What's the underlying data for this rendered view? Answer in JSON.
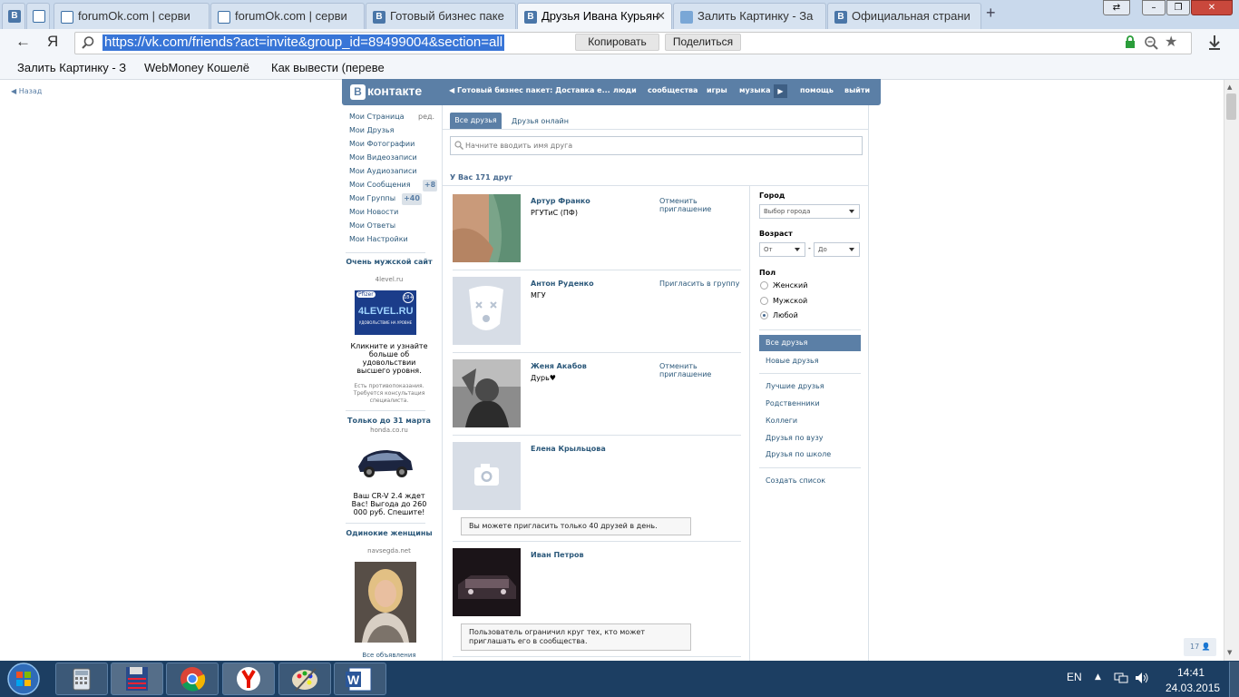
{
  "browser": {
    "tabs": [
      {
        "label": "forumOk.com | серви"
      },
      {
        "label": "forumOk.com | серви"
      },
      {
        "label": "Готовый бизнес паке"
      },
      {
        "label": "Друзья Ивана Курьян"
      },
      {
        "label": "Залить Картинку - За"
      },
      {
        "label": "Официальная страни"
      }
    ],
    "address": {
      "logo": "Я",
      "url": "https://vk.com/friends?act=invite&group_id=89499004&section=all",
      "copy_label": "Копировать",
      "share_label": "Поделиться"
    },
    "bookmarks": [
      "Залить Картинку - З",
      "WebMoney Кошелё",
      "Как вывести (переве"
    ]
  },
  "page": {
    "back_label": "Назад",
    "header": {
      "logo": "контакте",
      "logo_letter": "В",
      "app_link": "Готовый бизнес пакет: Доставка е...",
      "nav": [
        "люди",
        "сообщества",
        "игры",
        "музыка",
        "помощь",
        "выйти"
      ]
    },
    "sidebar": {
      "items": [
        "Мои Страница",
        "Мои Друзья",
        "Мои Фотографии",
        "Мои Видеозаписи",
        "Мои Аудиозаписи",
        "Мои Сообщения",
        "Мои Группы",
        "Мои Новости",
        "Мои Ответы",
        "Мои Настройки"
      ],
      "edit_label": "ред.",
      "messages_count": "+8",
      "groups_count": "+40",
      "ads": [
        {
          "title": "Очень мужской сайт",
          "site": "4level.ru",
          "image_brand": "4LEVEL.RU",
          "image_sub": "УДОВОЛЬСТВИЕ НА УРОВНЕ",
          "image_badge": "Pfizer",
          "image_age": "18+",
          "text": "Кликните и узнайте больше об удовольствии высшего уровня.",
          "disclaimer": "Есть противопоказания. Требуется консультация специалиста."
        },
        {
          "title": "Только до 31 марта",
          "site": "honda.co.ru",
          "text": "Ваш CR-V 2.4 ждет Вас! Выгода до 260 000 руб. Спешите!"
        },
        {
          "title": "Одинокие женщины",
          "site": "navsegda.net"
        }
      ],
      "all_ads_label": "Все объявления"
    },
    "main": {
      "tabs": [
        "Все друзья",
        "Друзья онлайн"
      ],
      "search_placeholder": "Начните вводить имя друга",
      "count_text": "У Вас 171 друг",
      "friends": [
        {
          "name": "Артур Франко",
          "sub": "РГУТиС (ПФ)",
          "action": "Отменить приглашение"
        },
        {
          "name": "Антон Руденко",
          "sub": "МГУ",
          "action": "Пригласить в группу"
        },
        {
          "name": "Женя Акабов",
          "sub": "Дурь♥",
          "action": "Отменить приглашение"
        },
        {
          "name": "Елена Крыльцова",
          "note": "Вы можете пригласить только 40 друзей в день."
        },
        {
          "name": "Иван Петров",
          "note": "Пользователь ограничил круг тех, кто может приглашать его в сообщества."
        }
      ]
    },
    "filters": {
      "city_label": "Город",
      "city_value": "Выбор города",
      "age_label": "Возраст",
      "age_from": "От",
      "age_to": "До",
      "age_sep": "-",
      "sex_label": "Пол",
      "sex_options": [
        "Женский",
        "Мужской",
        "Любой"
      ],
      "sex_selected": "Любой",
      "menu_active": "Все друзья",
      "menu": [
        "Новые друзья",
        "Лучшие друзья",
        "Родственники",
        "Коллеги",
        "Друзья по вузу",
        "Друзья по школе",
        "Создать список"
      ]
    },
    "counter": "17"
  },
  "taskbar": {
    "lang": "EN",
    "time": "14:41",
    "date": "24.03.2015"
  }
}
